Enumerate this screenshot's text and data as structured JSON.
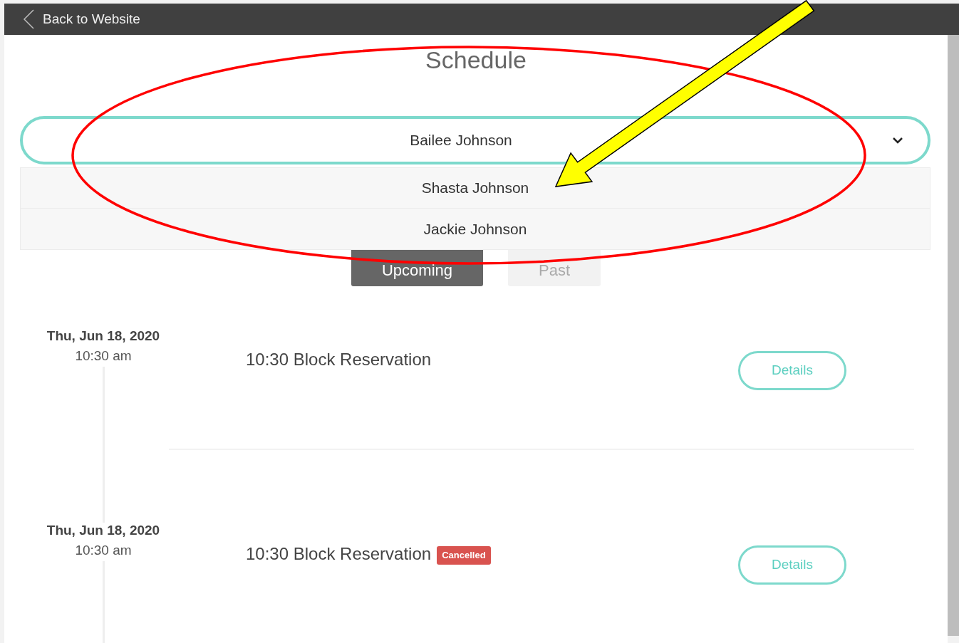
{
  "top_bar": {
    "back_link": "Back to Website"
  },
  "title": "Schedule",
  "person_dropdown": {
    "value": "Bailee Johnson",
    "expanded": true,
    "options": [
      "Shasta Johnson",
      "Jackie Johnson"
    ]
  },
  "tabs": [
    {
      "label": "Upcoming",
      "selected": true
    },
    {
      "label": "Past",
      "selected": false
    }
  ],
  "events": [
    {
      "date": "Thu, Jun 18, 2020",
      "time": "10:30 am",
      "title": "10:30 Block Reservation",
      "button": "Details"
    },
    {
      "date": "Thu, Jun 18, 2020",
      "time": "10:30 am",
      "title": "10:30 Block Reservation",
      "badge": "Cancelled",
      "button": "Details"
    }
  ],
  "annotations": [
    {
      "kind": "ellipse",
      "color": "#ff0000"
    },
    {
      "kind": "arrow",
      "color": "#ffff00"
    }
  ]
}
